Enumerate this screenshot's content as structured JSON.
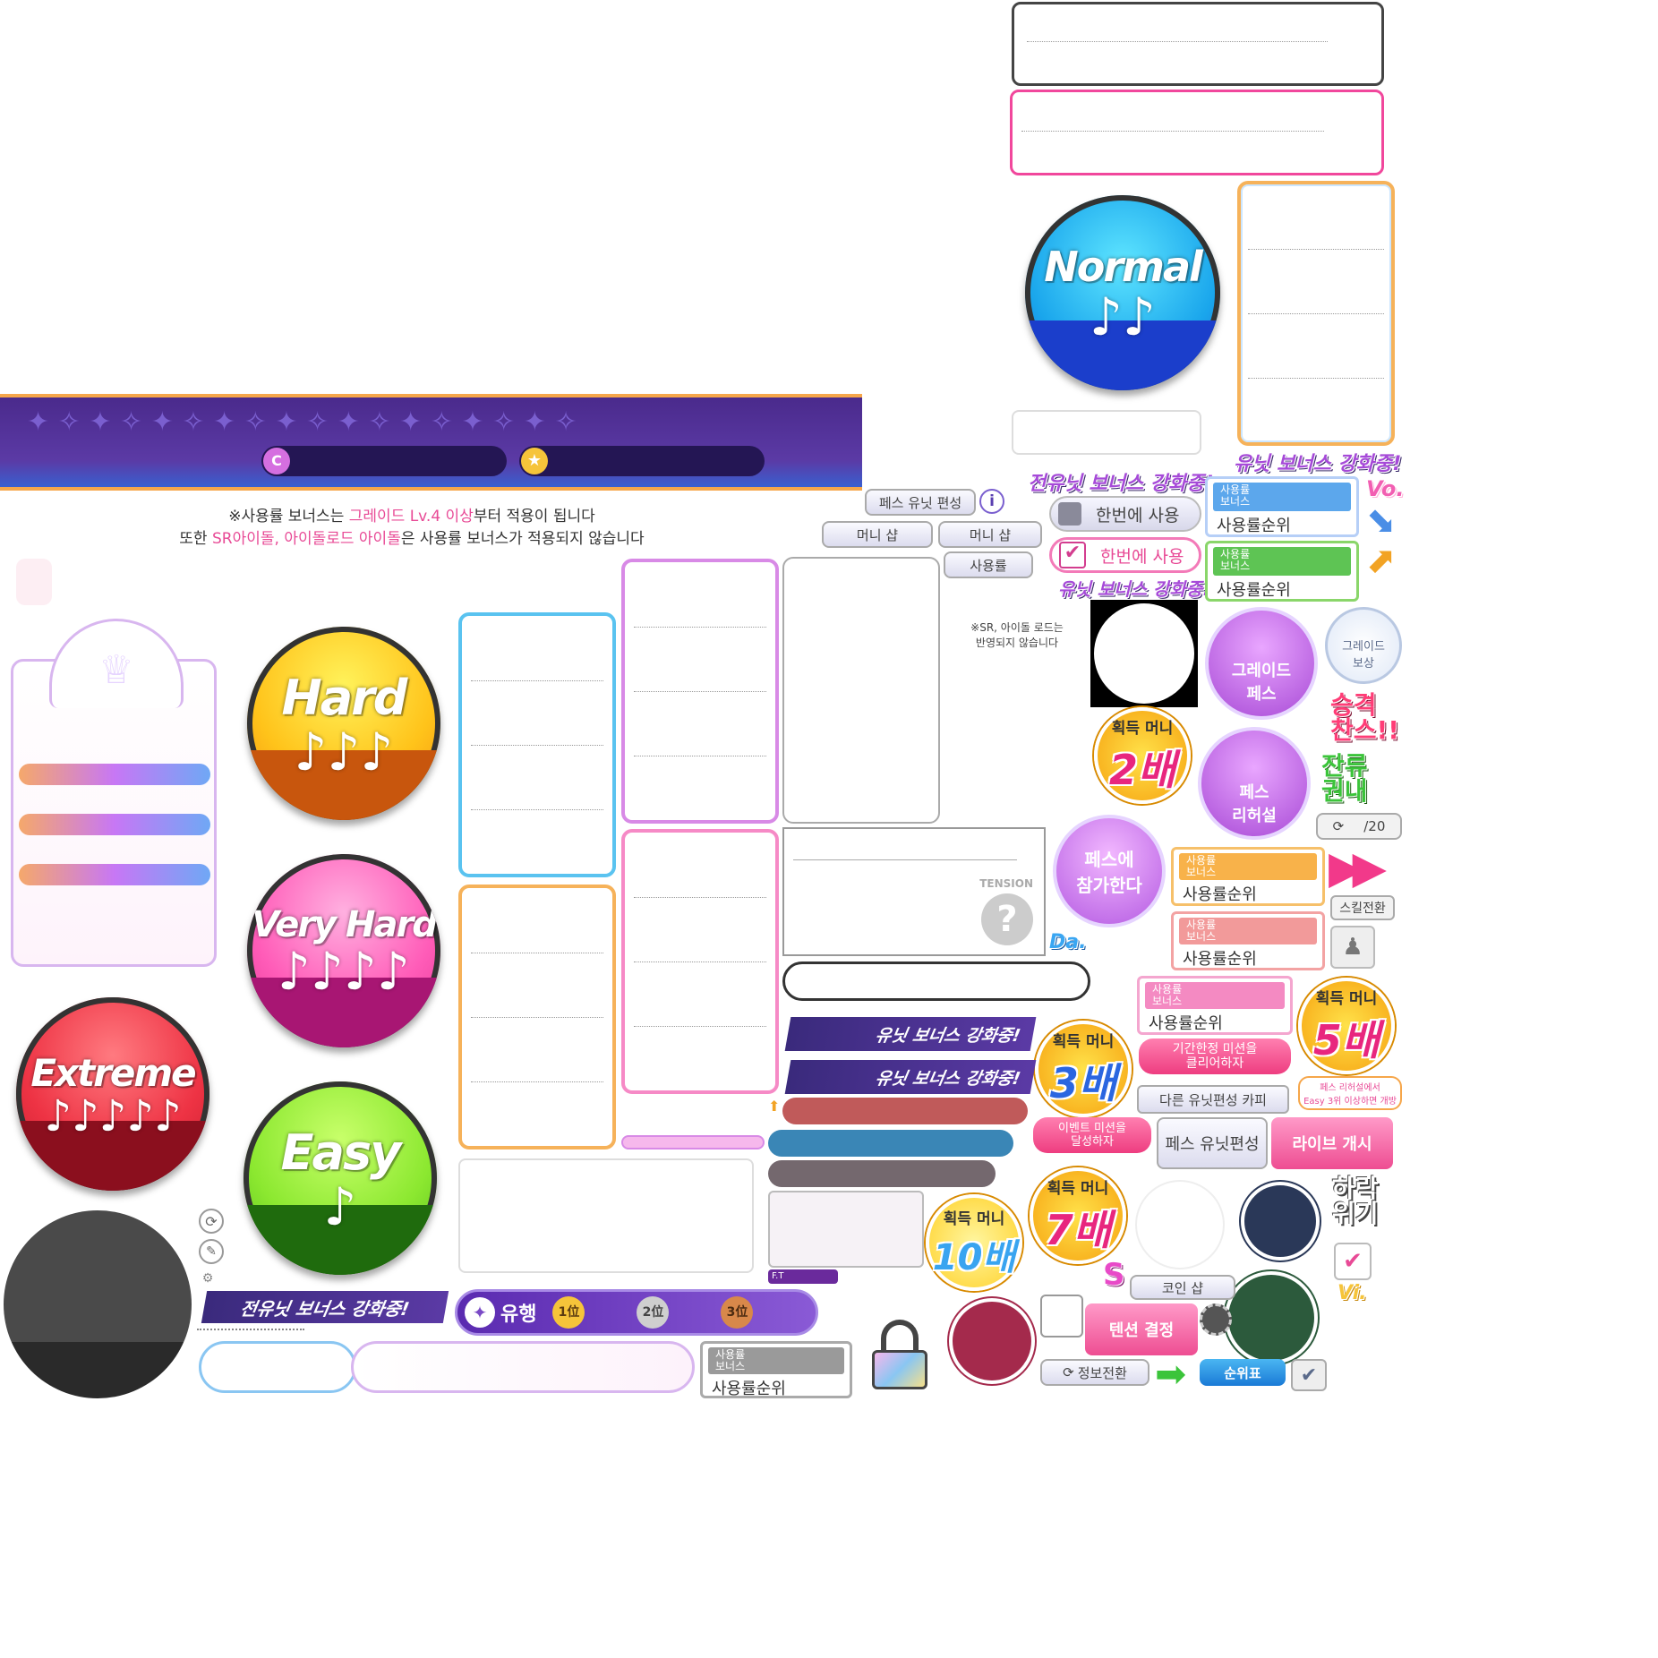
{
  "difficulty": {
    "normal": {
      "title": "Normal",
      "notes": "♪♪",
      "top": "#27c8f5",
      "bottom": "#1a3cc4"
    },
    "hard": {
      "title": "Hard",
      "notes": "♪♪♪",
      "top": "#ffd21a",
      "bottom": "#c8560d"
    },
    "very_hard": {
      "title": "Very Hard",
      "notes": "♪♪♪♪",
      "top": "#ff6fc0",
      "bottom": "#a81673"
    },
    "extreme": {
      "title": "Extreme",
      "notes": "♪♪♪♪♪",
      "top": "#f03b4a",
      "bottom": "#8b0f1e"
    },
    "easy": {
      "title": "Easy",
      "notes": "♪",
      "top": "#8cf03a",
      "bottom": "#1f6b0d"
    }
  },
  "notice": {
    "line1_pre": "※사용률 보너스는 ",
    "line1_hl": "그레이드 Lv.4 이상",
    "line1_post": "부터 적용이 됩니다",
    "line2_pre": "또한 ",
    "line2_hl": "SR아이돌, 아이돌로드 아이돌",
    "line2_post": "은 사용률 보너스가 적용되지 않습니다"
  },
  "header": {
    "coin_icon": "C",
    "star_icon": "★"
  },
  "buttons": {
    "fes_unit_edit": "페스 유닛 편성",
    "info_icon": "i",
    "money_shop": "머니 샵",
    "money_shop2": "머니 샵",
    "usage_rate": "사용률",
    "use_once": "한번에 사용",
    "use_once_checked": "한번에 사용",
    "sr_note": "※SR, 아이돌 로드는\n반영되지 않습니다",
    "grade_fes": "그레이드\n페스",
    "grade_reward": "그레이드\n보상",
    "fes_rehearsal": "페스\n리허설",
    "join_fes": "페스에\n참가한다",
    "counter": "/20",
    "skill_switch": "스킬전환",
    "limited_mission": "기간한정 미션을\n클리어하자",
    "copy_other_unit": "다른 유닛편성 카피",
    "event_mission": "이벤트 미션을\n달성하자",
    "fes_unit_edit2": "페스 유닛편성",
    "live_start": "라이브 개시",
    "fes_rehearsal_note": "페스 리허설에서\nEasy 3위 이상하면 개방",
    "coin_shop": "코인 샵",
    "tension_decide": "텐션 결정",
    "info_switch": "정보전환",
    "ranking": "순위표",
    "tension_label": "TENSION",
    "question": "?"
  },
  "banners": {
    "unit_bonus_1": "유닛 보너스 강화중!",
    "unit_bonus_2": "유닛 보너스 강화중!",
    "all_unit_bonus": "전유닛 보너스 강화중!",
    "all_unit_bonus_top": "전유닛 보너스 강화중!",
    "unit_bonus_top": "유닛 보너스 강화중!",
    "unit_bonus_mid": "유닛 보너스 강화중!"
  },
  "rank_box": {
    "top": "사용률\n보너스",
    "bottom": "사용률순위"
  },
  "badges": {
    "label": "획득 머니",
    "x2": "2배",
    "x3": "3배",
    "x5": "5배",
    "x7": "7배",
    "x10": "10배"
  },
  "side_text": {
    "promotion": "승격\n찬스!!",
    "stay": "잔류\n권내",
    "relegation": "하락\n위기",
    "vo": "Vo.",
    "da": "Da.",
    "vi": "Vi.",
    "s": "S"
  },
  "trend": {
    "label": "유행",
    "r1": "1位",
    "r2": "2位",
    "r3": "3位"
  },
  "ft": "F.T"
}
